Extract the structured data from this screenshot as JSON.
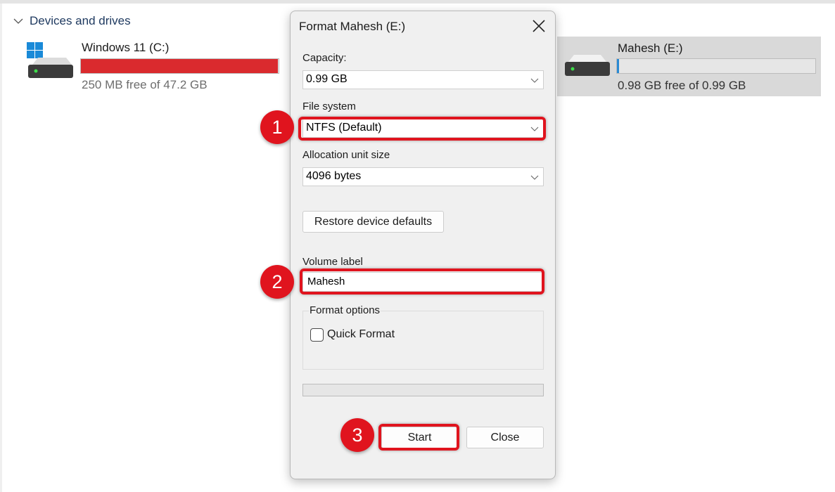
{
  "explorer": {
    "section_title": "Devices and drives",
    "drives": [
      {
        "name": "Windows 11 (C:)",
        "free_text": "250 MB free of 47.2 GB",
        "used_fraction": 0.995,
        "bar_color": "#da2a2e",
        "icon": "windows-drive-icon"
      },
      {
        "name": "Mahesh (E:)",
        "free_text": "0.98 GB free of 0.99 GB",
        "used_fraction": 0.01,
        "bar_color": "#2a8ad4",
        "icon": "drive-icon",
        "selected": true
      }
    ]
  },
  "dialog": {
    "title": "Format Mahesh (E:)",
    "capacity_label": "Capacity:",
    "capacity_value": "0.99 GB",
    "file_system_label": "File system",
    "file_system_value": "NTFS (Default)",
    "allocation_label": "Allocation unit size",
    "allocation_value": "4096 bytes",
    "restore_button": "Restore device defaults",
    "volume_label_label": "Volume label",
    "volume_label_value": "Mahesh",
    "format_options_label": "Format options",
    "quick_format_label": "Quick Format",
    "quick_format_checked": false,
    "progress_fraction": 0,
    "start_button": "Start",
    "close_button": "Close"
  },
  "annotations": {
    "accent_color": "#e0141e",
    "steps": [
      "1",
      "2",
      "3"
    ]
  }
}
